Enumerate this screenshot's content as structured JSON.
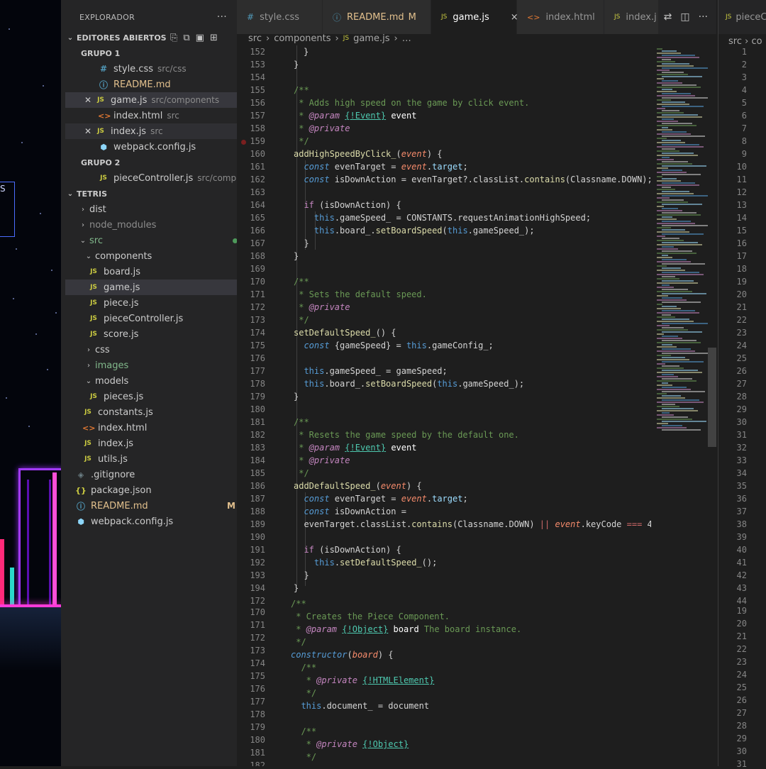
{
  "explorer": {
    "title": "EXPLORADOR",
    "more": "···",
    "open_editors_title": "EDITORES ABIERTOS",
    "group1": "GRUPO 1",
    "group2": "GRUPO 2",
    "open_editors": [
      {
        "name": "style.css",
        "desc": "src/css",
        "icon": "css-hash-icon"
      },
      {
        "name": "README.md",
        "desc": "",
        "badge": "M",
        "icon": "info-icon"
      },
      {
        "name": "game.js",
        "desc": "src/components",
        "icon": "js-icon"
      },
      {
        "name": "index.html",
        "desc": "src",
        "icon": "html-icon"
      },
      {
        "name": "index.js",
        "desc": "src",
        "icon": "js-icon"
      },
      {
        "name": "webpack.config.js",
        "desc": "",
        "icon": "webpack-icon"
      },
      {
        "name": "pieceController.js",
        "desc": "src/comp...",
        "icon": "js-icon"
      }
    ],
    "project_title": "TETRIS",
    "tree": {
      "dist": "dist",
      "node_modules": "node_modules",
      "src": "src",
      "components": "components",
      "board": "board.js",
      "game": "game.js",
      "piece": "piece.js",
      "pieceController": "pieceController.js",
      "score": "score.js",
      "css": "css",
      "images": "images",
      "models": "models",
      "pieces": "pieces.js",
      "constants": "constants.js",
      "index_html": "index.html",
      "index_js": "index.js",
      "utils": "utils.js",
      "gitignore": ".gitignore",
      "package": "package.json",
      "readme": "README.md",
      "readme_badge": "M",
      "webpack": "webpack.config.js"
    }
  },
  "tabs": [
    {
      "label": "style.css",
      "icon": "#"
    },
    {
      "label": "README.md",
      "modified": "M",
      "icon": "ⓘ"
    },
    {
      "label": "game.js",
      "icon": "JS",
      "close": "×"
    },
    {
      "label": "index.html",
      "icon": "<>"
    },
    {
      "label": "index.j",
      "icon": "JS"
    }
  ],
  "breadcrumb": {
    "a": "src",
    "b": "components",
    "c": "game.js",
    "d": "…"
  },
  "pane2": {
    "tab": "pieceC",
    "crumb": "src › co",
    "lines": [
      "1",
      "2",
      "3",
      "4",
      "5",
      "6",
      "7",
      "8",
      "9",
      "10",
      "11",
      "12",
      "13",
      "14",
      "15",
      "16",
      "17",
      "18",
      "19",
      "20",
      "21",
      "22",
      "23",
      "24",
      "25",
      "26",
      "27",
      "28",
      "29",
      "30",
      "31",
      "32",
      "33",
      "34",
      "35",
      "36",
      "37",
      "38",
      "39",
      "40",
      "41",
      "42",
      "43",
      "44",
      "19",
      "20",
      "21",
      "22",
      "23",
      "24",
      "25",
      "26",
      "27",
      "28",
      "29",
      "30",
      "31"
    ]
  },
  "game_background": {
    "label": "S"
  },
  "code_lines": {
    "l152": "152",
    "l153": "153",
    "l154": "154",
    "l155": "155",
    "l156": "156",
    "l157": "157",
    "l158": "158",
    "l159": "159",
    "l160": "160",
    "l161": "161",
    "l162": "162",
    "l163": "163",
    "l164": "164",
    "l165": "165",
    "l166": "166",
    "l167": "167",
    "l168": "168",
    "l169": "169",
    "l170": "170",
    "l171": "171",
    "l172": "172",
    "l173": "173",
    "l174": "174",
    "l175": "175",
    "l176": "176",
    "l177": "177",
    "l178": "178",
    "l179": "179",
    "l180": "180",
    "l181": "181",
    "l182": "182",
    "l183": "183",
    "l184": "184",
    "l185": "185",
    "l186": "186",
    "l187": "187",
    "l188": "188",
    "l189": "189",
    "l190": "190",
    "l191": "191",
    "l192": "192",
    "l193": "193",
    "l194": "194",
    "p172": "172",
    "p170": "170",
    "p171": "171",
    "p172b": "172",
    "p173": "173",
    "p174": "174",
    "p175": "175",
    "p176": "176",
    "p177": "177",
    "p178": "178",
    "p179": "179",
    "p180": "180",
    "p181": "181",
    "p182": "182"
  },
  "code": {
    "c156": " * Adds high speed on the game by click event.",
    "c171": " * Sets the default speed.",
    "c182": " * Resets the game speed by the default one.",
    "c_piece": " * Creates the Piece Component.",
    "board_desc": " The board instance.",
    "fn_high": "addHighSpeedByClick_",
    "fn_default": "setDefaultSpeed_",
    "fn_adddefault": "addDefaultSpeed_",
    "ctor": "constructor"
  }
}
